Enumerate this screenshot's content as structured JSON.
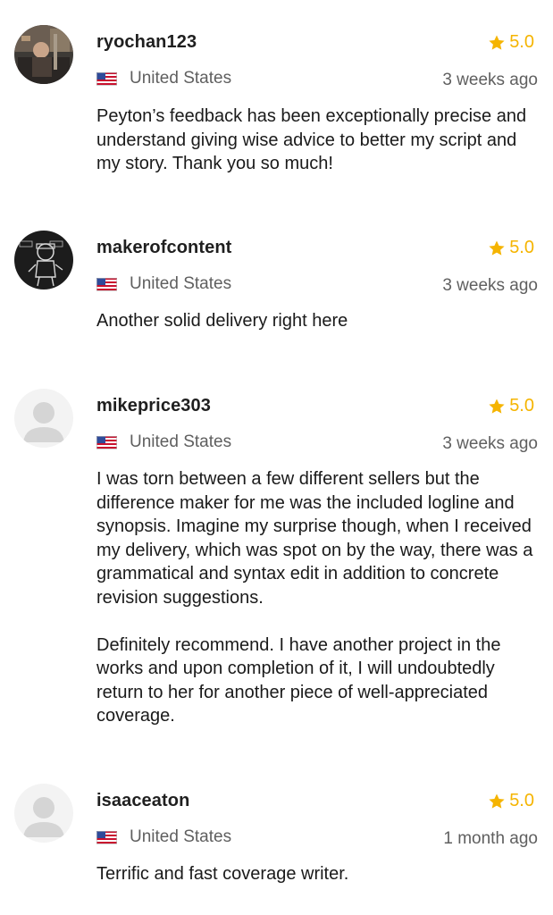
{
  "reviews": [
    {
      "username": "ryochan123",
      "rating": "5.0",
      "country": "United States",
      "time": "3 weeks ago",
      "paragraphs": [
        "Peyton’s feedback has been exceptionally precise and understand giving wise advice to better my script and my story. Thank you so much!"
      ]
    },
    {
      "username": "makerofcontent",
      "rating": "5.0",
      "country": "United States",
      "time": "3 weeks ago",
      "paragraphs": [
        "Another solid delivery right here"
      ]
    },
    {
      "username": "mikeprice303",
      "rating": "5.0",
      "country": "United States",
      "time": "3 weeks ago",
      "paragraphs": [
        "I was torn between a few different sellers but the difference maker for me was the included logline and synopsis. Imagine my surprise though, when I received my delivery, which was spot on by the way, there was a grammatical and syntax edit in addition to concrete revision suggestions.",
        "Definitely recommend. I have another project in the works and upon completion of it, I will undoubtedly return to her for another piece of well-appreciated coverage."
      ]
    },
    {
      "username": "isaaceaton",
      "rating": "5.0",
      "country": "United States",
      "time": "1 month ago",
      "paragraphs": [
        "Terrific and fast coverage writer."
      ]
    }
  ],
  "icons": {
    "star": "star-icon",
    "flag": "us-flag-icon",
    "avatar_default": "default-user-avatar"
  },
  "colors": {
    "star": "#f5b400",
    "muted_text": "#5f5f5f",
    "body_text": "#1a1a1a"
  }
}
